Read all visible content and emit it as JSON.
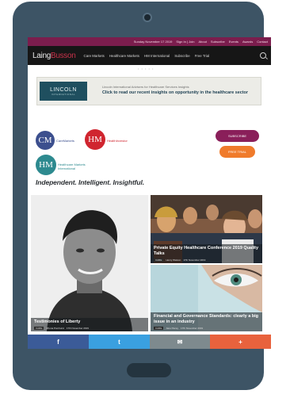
{
  "topbar": {
    "date": "Sunday November 17 2019",
    "links": [
      "Sign In | Join",
      "About",
      "Subscribe",
      "Events",
      "Awards",
      "Contact"
    ]
  },
  "nav": {
    "logo_main": "Laing",
    "logo_accent": "Busson",
    "items": [
      "Care Markets",
      "Healthcare Markets",
      "HM International",
      "Subscribe",
      "Free Trial"
    ]
  },
  "ad": {
    "logo": "LINCOLN",
    "logo_sub": "INTERNATIONAL",
    "line1": "Lincoln International Advisers for Healthcare Services Insights",
    "line2": "Click to read our recent insights on opportunity in the healthcare sector"
  },
  "brands": {
    "cm": {
      "mark": "CM",
      "label": "CareMarkets",
      "color": "#3c4f8e"
    },
    "hm": {
      "mark": "HM",
      "label": "HealthInvestor",
      "color": "#d0252f"
    },
    "hmi": {
      "mark": "HM",
      "label": "Healthcare Markets International",
      "color": "#2d8a8f"
    }
  },
  "buttons": {
    "subscribe": "SUBSCRIBE",
    "free_trial": "FREE TRIAL",
    "subscribe_color": "#8a1f5a",
    "trial_color": "#f07b2b"
  },
  "tagline": "Independent. Intelligent. Insightful.",
  "articles": [
    {
      "title": "Testimonies of Liberty",
      "tag": "CARE",
      "author": "Rhona Pomhurst",
      "date": "17th November 2019"
    },
    {
      "title": "Private Equity Healthcare Conference 2019 Quality Talks",
      "tag": "CARE",
      "author": "Henry Watson",
      "date": "17th November 2019"
    },
    {
      "title": "Financial and Governance Standards: clearly a big issue in an industry",
      "tag": "CARE",
      "author": "Jane Pacey",
      "date": "17th November 2019"
    }
  ],
  "share": [
    {
      "icon": "f",
      "color": "#3b5b98"
    },
    {
      "icon": "t",
      "color": "#3aa0e0"
    },
    {
      "icon": "✉",
      "color": "#7e8a8e"
    },
    {
      "icon": "+",
      "color": "#e8623d"
    }
  ]
}
